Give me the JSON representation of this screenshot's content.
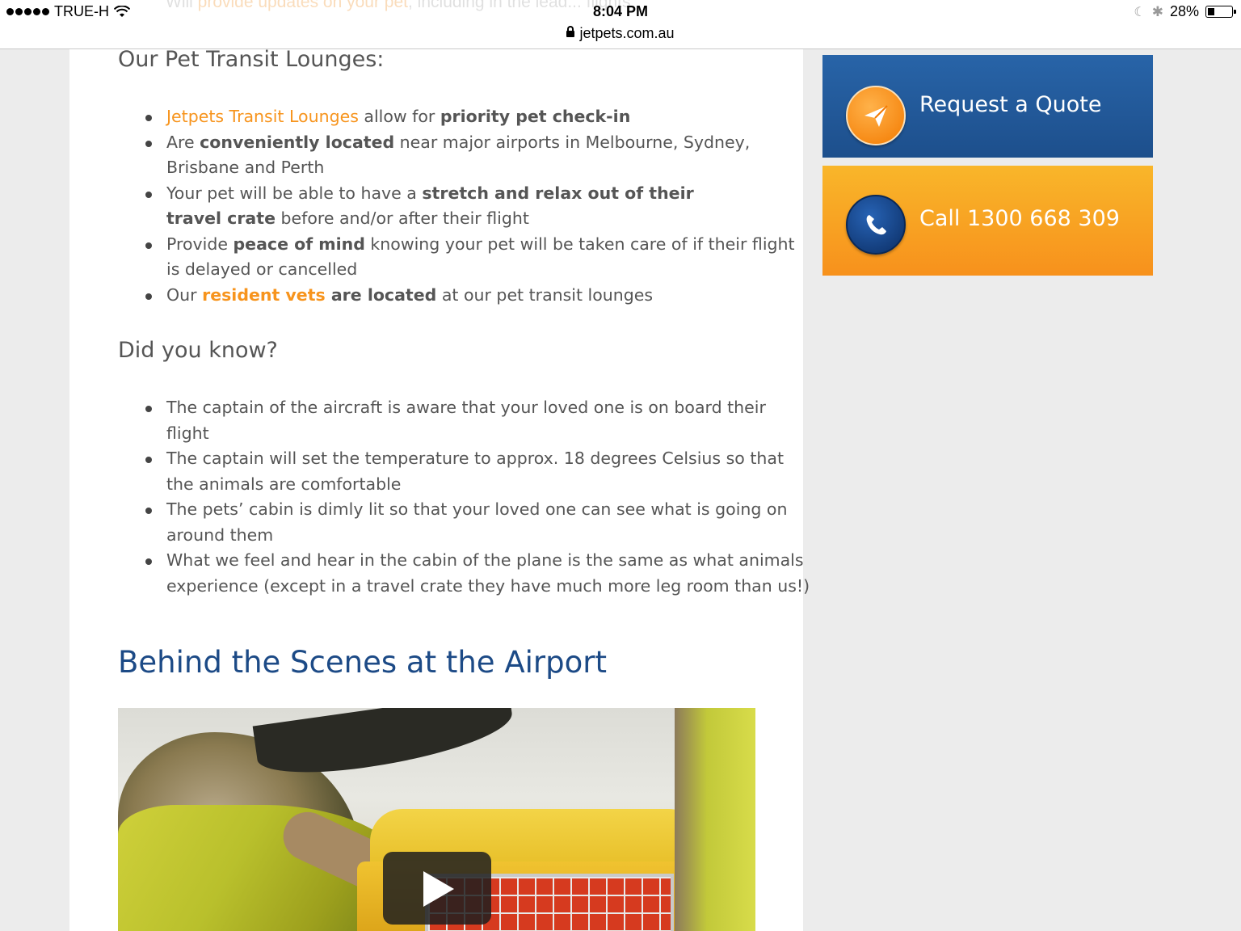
{
  "status_bar": {
    "carrier": "TRUE-H",
    "time": "8:04 PM",
    "url": "jetpets.com.au",
    "battery": "28%",
    "battery_level": 0.28
  },
  "ghost_text": {
    "prefix": "Will ",
    "link": "provide updates on your pet",
    "suffix": ", including in the lead... flights"
  },
  "transit": {
    "title": "Our Pet Transit Lounges:",
    "items": [
      {
        "a_link": "Jetpets Transit Lounges",
        "b": " allow for ",
        "c_bold": "priority pet check-in"
      },
      {
        "a": "Are ",
        "b_bold": "conveniently located",
        "c": " near major airports in Melbourne, Sydney, Brisbane and Perth"
      },
      {
        "a": "Your pet will be able to have a ",
        "b_bold": "stretch and relax out of their travel crate",
        "c": " before and/or after their flight"
      },
      {
        "a": "Provide ",
        "b_bold": "peace of mind",
        "c": " knowing your pet will be taken care of if their flight is delayed or cancelled"
      },
      {
        "a": "Our ",
        "b_link": "resident vets",
        "c_bold": " are located",
        "d": " at our pet transit lounges"
      }
    ]
  },
  "did_you_know": {
    "title": "Did you know?",
    "items": [
      "The captain of the aircraft is aware that your loved one is on board their flight",
      "The captain will set the temperature to approx. 18 degrees Celsius so that the animals are comfortable",
      "The pets’ cabin is dimly lit so that your loved one can see what is going on around them",
      "What we feel and hear in the cabin of the plane is the same as what animals experience (except in a travel crate they have much more leg room than us!)"
    ]
  },
  "behind_scenes": {
    "title": "Behind the Scenes at the Airport"
  },
  "sidebar": {
    "quote_label": "Request a Quote",
    "call_label": "Call 1300 668 309"
  },
  "colors": {
    "link_orange": "#f7941d",
    "heading_blue": "#1c4a86",
    "quote_blue": "#1d4f8c",
    "call_orange": "#f7911c"
  },
  "icons": {
    "quote": "paper-plane-icon",
    "call": "phone-icon",
    "video": "play-icon"
  }
}
